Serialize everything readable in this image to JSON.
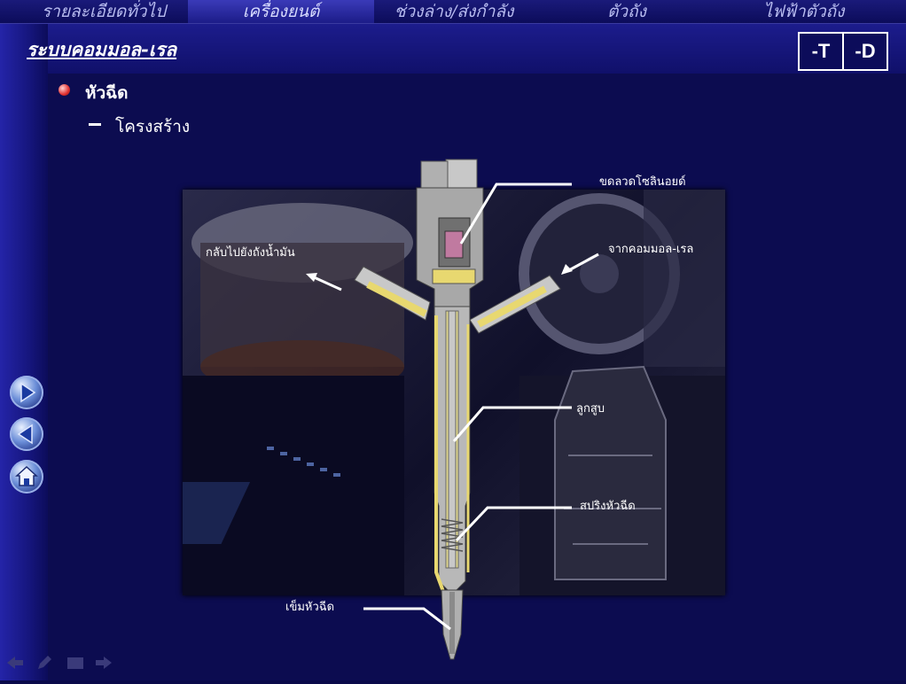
{
  "nav": {
    "tabs": [
      {
        "label": "รายละเอียดทั่วไป",
        "active": false
      },
      {
        "label": "เครื่องยนต์",
        "active": true
      },
      {
        "label": "ช่วงล่าง/ส่งกำลัง",
        "active": false
      },
      {
        "label": "ตัวถัง",
        "active": false
      },
      {
        "label": "ไฟฟ้าตัวถัง",
        "active": false
      }
    ]
  },
  "header": {
    "title": "ระบบคอมมอล-เรล",
    "btn_t": "-T",
    "btn_d": "-D"
  },
  "content": {
    "heading": "หัวฉีด",
    "subheading": "โครงสร้าง"
  },
  "diagram": {
    "labels": {
      "solenoid": "ขดลวดโซลินอยด์",
      "return": "กลับไปยังถังน้ำมัน",
      "from_rail": "จากคอมมอล-เรล",
      "piston": "ลูกสูบ",
      "spring": "สปริงหัวฉีด",
      "needle": "เข็มหัวฉีด"
    }
  },
  "side_nav": {
    "icons": [
      "forward-icon",
      "back-icon",
      "home-icon"
    ]
  },
  "toolbar": {
    "icons": [
      "prev-arrow-icon",
      "pencil-icon",
      "menu-icon",
      "next-arrow-icon"
    ]
  },
  "colors": {
    "background": "#0a0a4a",
    "accent": "#2424a8",
    "injector_fuel": "#e8d870"
  }
}
